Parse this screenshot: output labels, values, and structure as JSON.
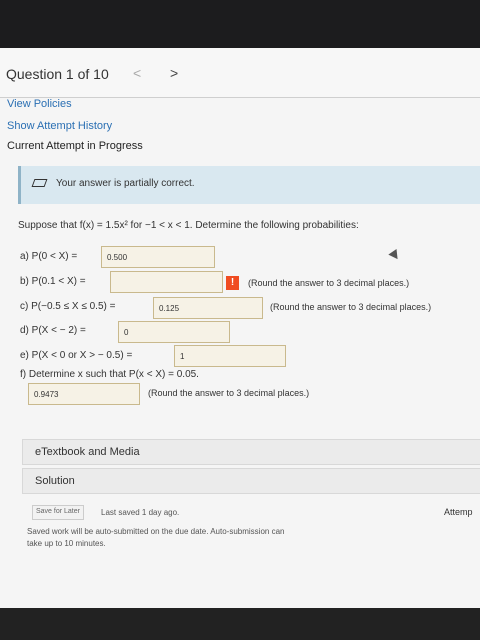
{
  "header": {
    "title": "Question 1 of 10",
    "prev_label": "<",
    "next_label": ">"
  },
  "links": {
    "view_policies": "View Policies",
    "history": "Show Attempt History",
    "current": "Current Attempt in Progress"
  },
  "alert": {
    "text": "Your answer is partially correct."
  },
  "question": {
    "text": "Suppose that f(x) = 1.5x² for −1 < x < 1. Determine the following probabilities:"
  },
  "parts": {
    "a": {
      "label": "a) P(0 < X) =",
      "value": "0.500"
    },
    "b": {
      "label": "b) P(0.1 < X) =",
      "value": "",
      "warning": "!",
      "hint": "(Round the answer to 3 decimal places.)"
    },
    "c": {
      "label": "c) P(−0.5 ≤ X ≤ 0.5) =",
      "value": "0.125",
      "hint": "(Round the answer to 3 decimal places.)"
    },
    "d": {
      "label": "d) P(X < − 2) =",
      "value": "0"
    },
    "e": {
      "label": "e) P(X < 0 or X > − 0.5) =",
      "value": "1"
    },
    "f": {
      "label": "f) Determine x such that P(x < X) = 0.05.",
      "value": "0.9473",
      "hint": "(Round the answer to 3 decimal places.)"
    }
  },
  "panels": {
    "etextbook": "eTextbook and Media",
    "solution": "Solution"
  },
  "footer": {
    "save_label": "Save for Later",
    "saved": "Last saved 1 day ago.",
    "submit_note": "Saved work will be auto-submitted on the due date. Auto-submission can take up to 10 minutes.",
    "attempts": "Attemp"
  }
}
